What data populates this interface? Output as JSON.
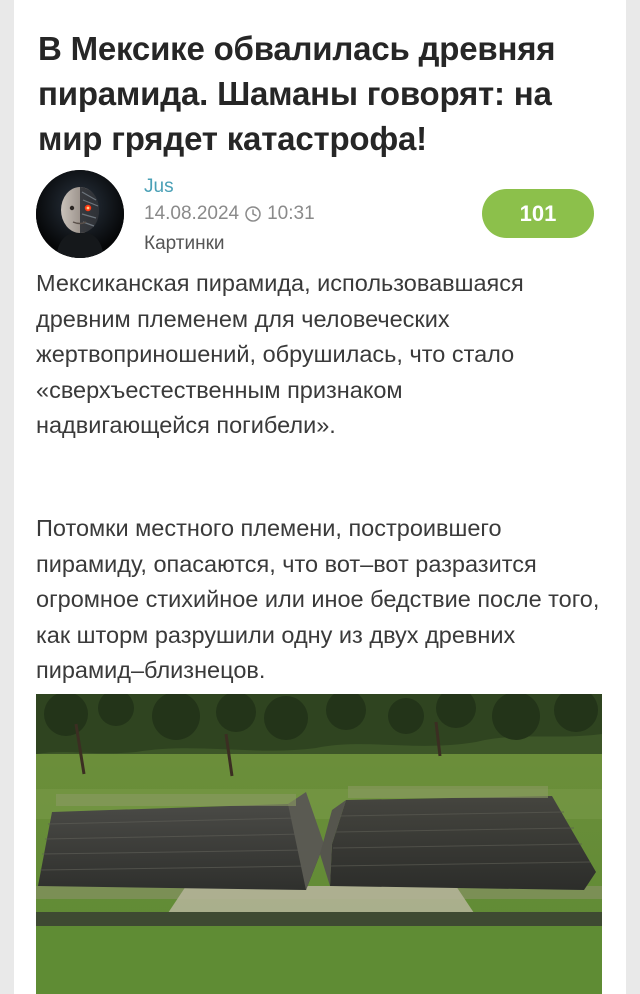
{
  "post": {
    "title": "В Мексике обвалилась древняя пирамида. Шаманы говорят: на мир грядет катастрофа!",
    "author": "Jus",
    "date": "14.08.2024",
    "time": "10:31",
    "category": "Картинки",
    "score": "101",
    "paragraphs": [
      "Мексиканская пирамида, использовавшаяся древним племенем для человеческих жертвоприношений, обрушилась, что стало «сверхъестественным признаком надвигающейся погибели».",
      "Потомки местного племени, построившего пирамиду, опасаются, что вот–вот разразится огромное стихийное или иное бедствие после того, как шторм разрушили одну из двух древних пирамид–близнецов."
    ]
  },
  "colors": {
    "author": "#4aa0b6",
    "score_bg": "#8cc04b",
    "meta": "#8a8a8a"
  },
  "icons": {
    "clock": "clock-icon"
  }
}
